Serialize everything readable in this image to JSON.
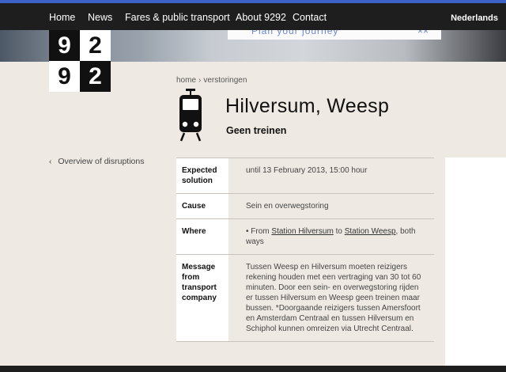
{
  "nav": {
    "items": [
      "Home",
      "News",
      "Fares & public transport",
      "About 9292",
      "Contact"
    ],
    "language": "Nederlands"
  },
  "hero": {
    "card_text": "Plan your journey",
    "card_mark": "××"
  },
  "logo": {
    "digits": [
      "9",
      "2",
      "9",
      "2"
    ]
  },
  "breadcrumb": {
    "home": "home",
    "separator": "›",
    "current": "verstoringen"
  },
  "page": {
    "title": "Hilversum, Weesp",
    "subtitle": "Geen treinen",
    "back_link": "Overview of disruptions",
    "icon": "train-icon"
  },
  "details": {
    "expected_label": "Expected solution",
    "expected_value": "until 13 February 2013, 15:00 hour",
    "cause_label": "Cause",
    "cause_value": "Sein en overwegstoring",
    "where_label": "Where",
    "where_prefix": "From",
    "where_from": "Station Hilversum",
    "where_to_word": "to",
    "where_to": "Station Weesp",
    "where_suffix": ", both ways",
    "message_label": "Message from transport company",
    "message_value": "Tussen Weesp en Hilversum moeten reizigers rekening houden met een vertraging van 30 tot 60 minuten. Door een sein- en overwegstoring rijden er tussen Hilversum en Weesp geen treinen maar bussen. *Doorgaande reizigers tussen Amersfoort en Amsterdam Centraal en tussen Hilversum en Schiphol kunnen omreizen via Utrecht Centraal."
  },
  "colors": {
    "nav_bg": "#1e1e1e",
    "accent_stripe": "#3b62c7",
    "page_bg": "#eeeae3"
  }
}
